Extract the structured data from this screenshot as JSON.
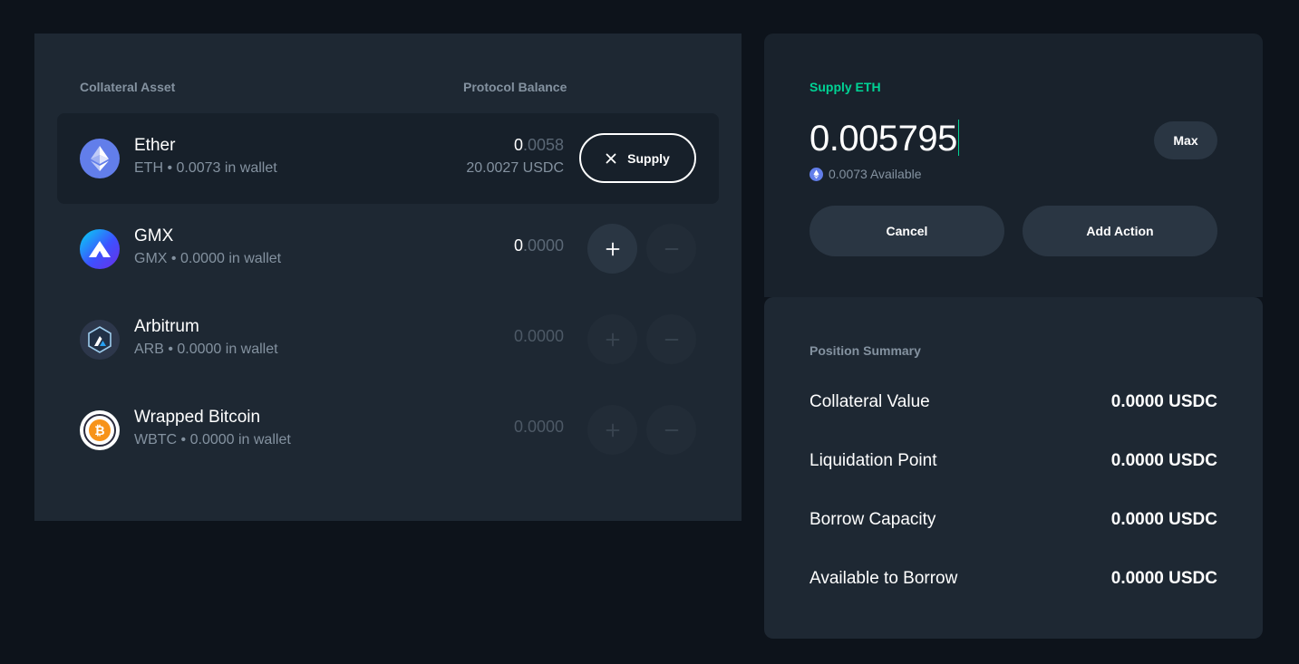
{
  "table": {
    "header_asset": "Collateral Asset",
    "header_balance": "Protocol Balance"
  },
  "assets": [
    {
      "name": "Ether",
      "sub": "ETH • 0.0073 in wallet",
      "balance_whole": "0",
      "balance_frac": ".0058",
      "balance_usd": "20.0027 USDC",
      "action_label": "Supply",
      "icon": "ethereum-icon",
      "color": "#627eea"
    },
    {
      "name": "GMX",
      "sub": "GMX • 0.0000 in wallet",
      "balance_whole": "0",
      "balance_frac": ".0000",
      "icon": "gmx-icon",
      "color": "#3d51ff"
    },
    {
      "name": "Arbitrum",
      "sub": "ARB • 0.0000 in wallet",
      "balance": "0.0000",
      "icon": "arbitrum-icon",
      "color": "#2d374b"
    },
    {
      "name": "Wrapped Bitcoin",
      "sub": "WBTC • 0.0000 in wallet",
      "balance": "0.0000",
      "icon": "bitcoin-icon",
      "color": "#f7931a"
    }
  ],
  "supply": {
    "label": "Supply ETH",
    "amount": "0.005795",
    "available": "0.0073 Available",
    "max_label": "Max",
    "cancel_label": "Cancel",
    "add_action_label": "Add Action",
    "accent": "#00d395"
  },
  "summary": {
    "title": "Position Summary",
    "rows": [
      {
        "label": "Collateral Value",
        "value": "0.0000 USDC"
      },
      {
        "label": "Liquidation Point",
        "value": "0.0000 USDC"
      },
      {
        "label": "Borrow Capacity",
        "value": "0.0000 USDC"
      },
      {
        "label": "Available to Borrow",
        "value": "0.0000 USDC"
      }
    ]
  }
}
